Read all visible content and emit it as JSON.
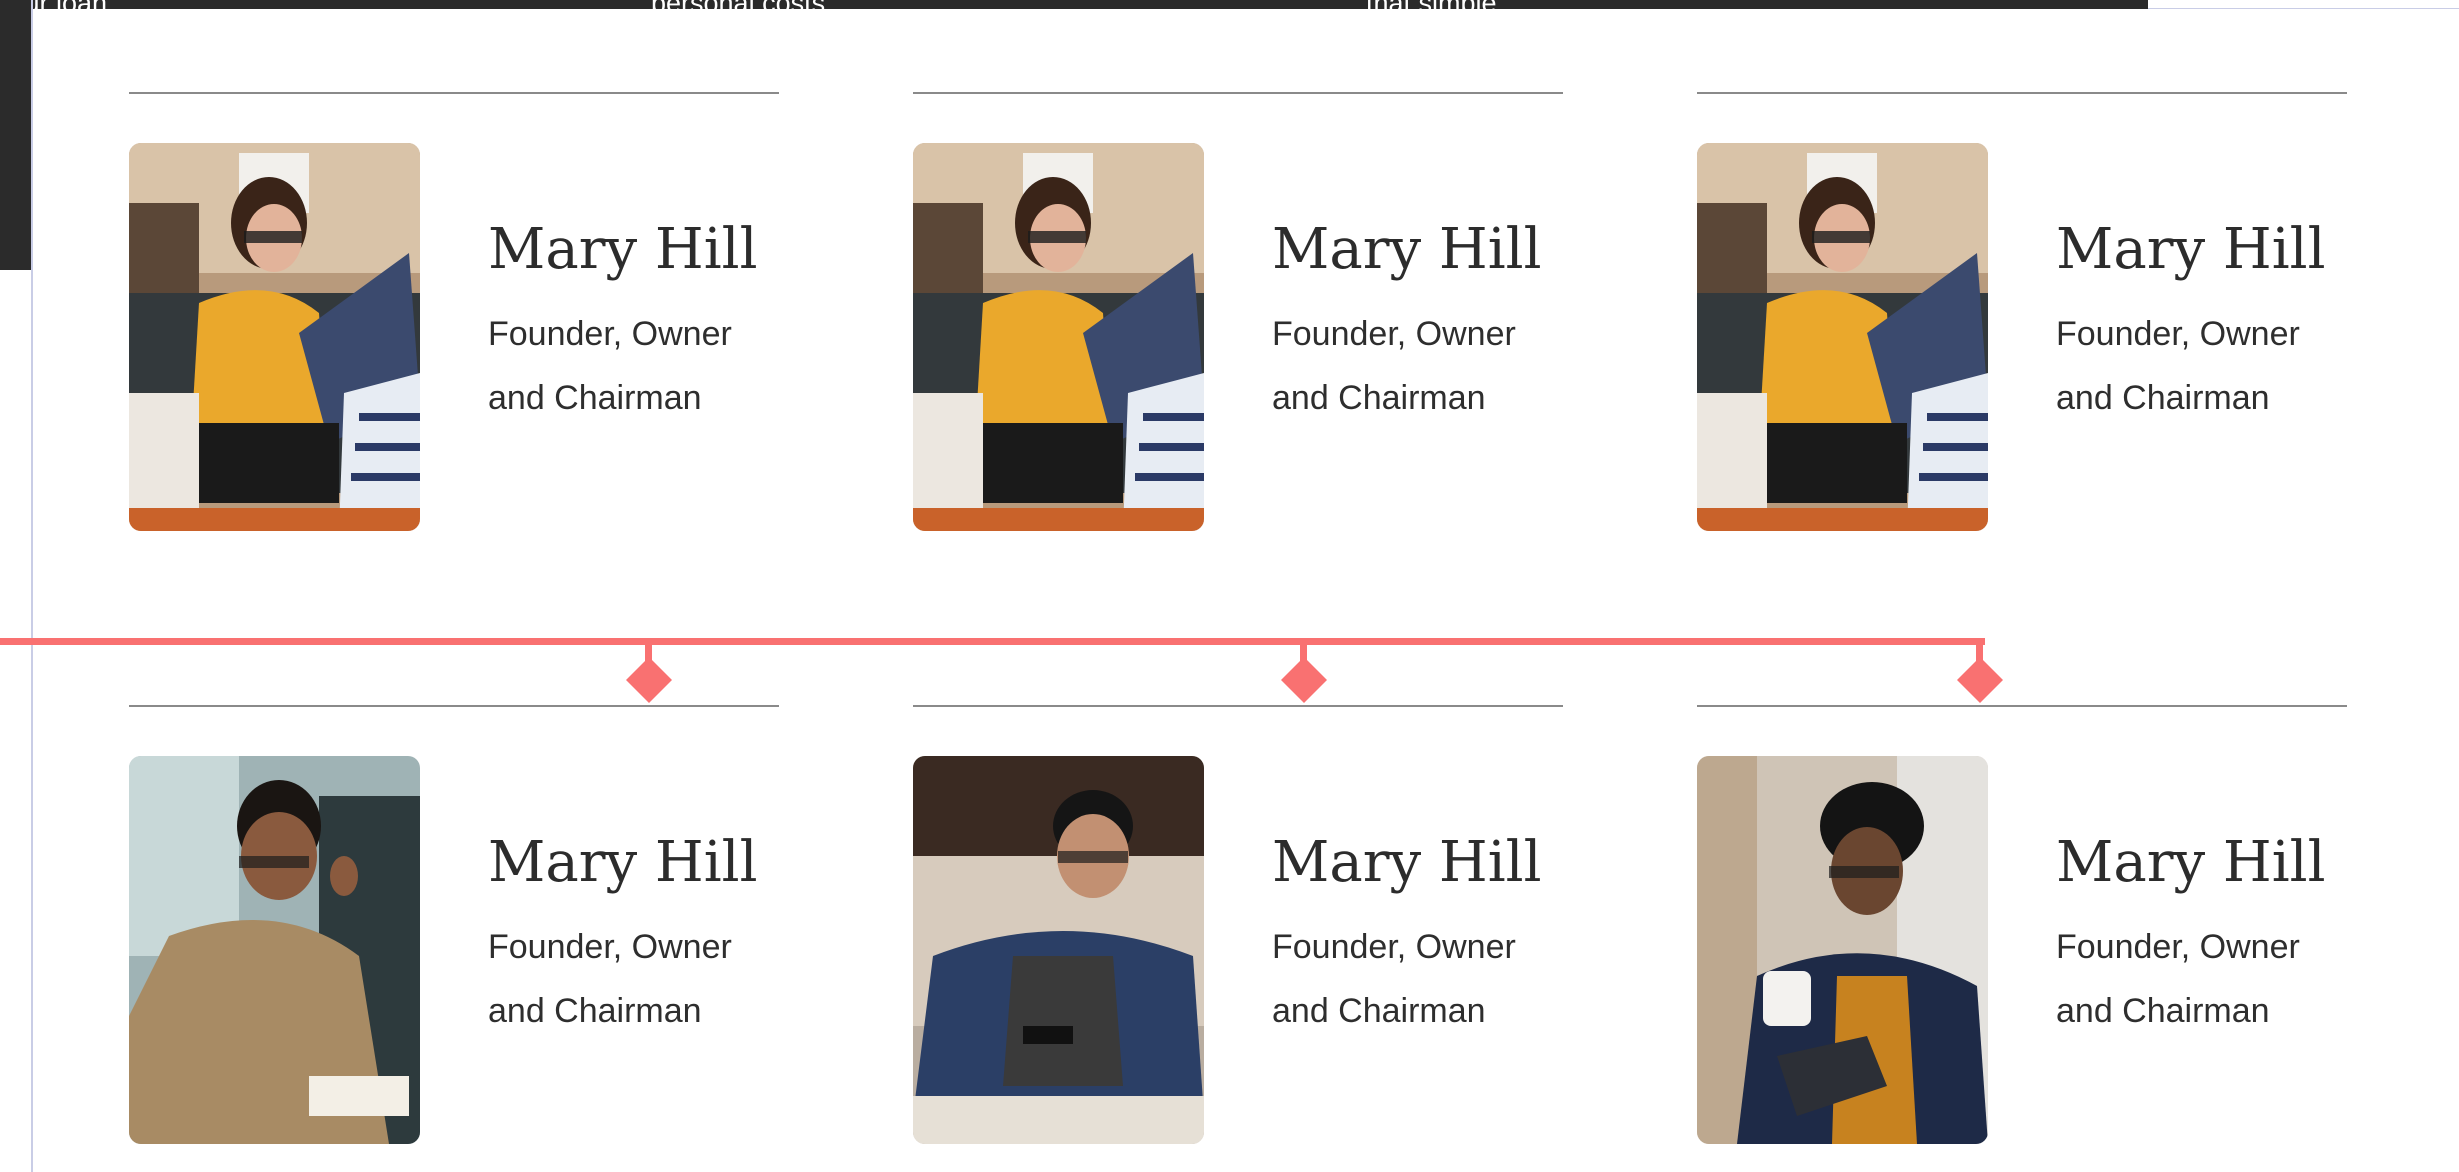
{
  "top_bar": {
    "fragments": [
      "your loan",
      "personal costs",
      "that simple"
    ]
  },
  "colors": {
    "accent": "#f97171",
    "rule": "#8a8a8a",
    "text": "#2c2c2c",
    "dark_bar": "#2b2b2b",
    "guide": "#c9cde6"
  },
  "team": [
    {
      "name": "Mary Hill",
      "role": "Founder, Owner and Chairman",
      "photo": "woman-laptop-photo"
    },
    {
      "name": "Mary Hill",
      "role": "Founder, Owner and Chairman",
      "photo": "woman-laptop-photo"
    },
    {
      "name": "Mary Hill",
      "role": "Founder, Owner and Chairman",
      "photo": "woman-laptop-photo"
    },
    {
      "name": "Mary Hill",
      "role": "Founder, Owner and Chairman",
      "photo": "man-headset-photo"
    },
    {
      "name": "Mary Hill",
      "role": "Founder, Owner and Chairman",
      "photo": "man-phone-photo"
    },
    {
      "name": "Mary Hill",
      "role": "Founder, Owner and Chairman",
      "photo": "man-tablet-photo"
    }
  ]
}
